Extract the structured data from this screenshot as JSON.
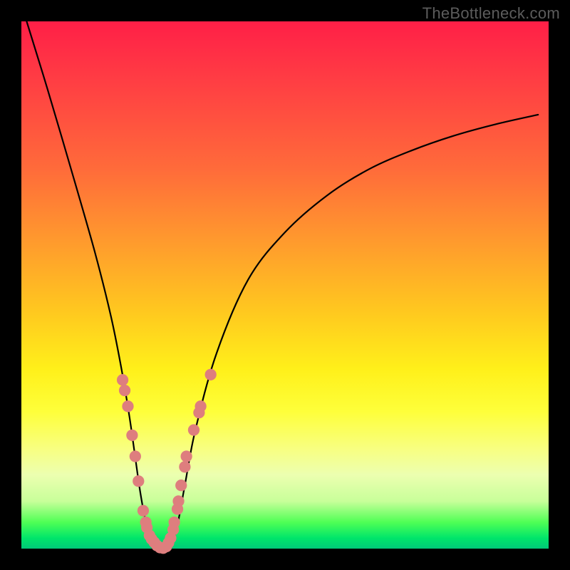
{
  "watermark": "TheBottleneck.com",
  "colors": {
    "frame_bg": "#000000",
    "curve": "#000000",
    "dot_fill": "#de7e7e",
    "dot_stroke": "#c46b6b",
    "gradient_stops": [
      "#ff1f47",
      "#ff6b3a",
      "#ffc81f",
      "#feff3a",
      "#4fff55",
      "#00c878"
    ]
  },
  "chart_data": {
    "type": "line",
    "title": "",
    "xlabel": "",
    "ylabel": "",
    "xlim": [
      0,
      1
    ],
    "ylim": [
      0,
      1
    ],
    "note": "Abstract V-shaped bottleneck curve on gradient background; no axis ticks or numeric labels are rendered in the image.",
    "series": [
      {
        "name": "bottleneck-curve",
        "x": [
          0.01,
          0.05,
          0.1,
          0.14,
          0.17,
          0.19,
          0.205,
          0.215,
          0.225,
          0.235,
          0.245,
          0.255,
          0.27,
          0.283,
          0.295,
          0.31,
          0.33,
          0.37,
          0.43,
          0.5,
          0.58,
          0.66,
          0.74,
          0.82,
          0.9,
          0.98
        ],
        "y": [
          1.0,
          0.87,
          0.7,
          0.56,
          0.44,
          0.34,
          0.25,
          0.18,
          0.11,
          0.055,
          0.018,
          0.005,
          0.0,
          0.005,
          0.04,
          0.12,
          0.225,
          0.37,
          0.51,
          0.6,
          0.67,
          0.72,
          0.755,
          0.783,
          0.805,
          0.823
        ]
      }
    ],
    "dots": [
      {
        "x": 0.192,
        "y": 0.32
      },
      {
        "x": 0.196,
        "y": 0.3
      },
      {
        "x": 0.202,
        "y": 0.27
      },
      {
        "x": 0.21,
        "y": 0.215
      },
      {
        "x": 0.216,
        "y": 0.175
      },
      {
        "x": 0.222,
        "y": 0.128
      },
      {
        "x": 0.231,
        "y": 0.072
      },
      {
        "x": 0.236,
        "y": 0.05
      },
      {
        "x": 0.238,
        "y": 0.04
      },
      {
        "x": 0.243,
        "y": 0.025
      },
      {
        "x": 0.247,
        "y": 0.018
      },
      {
        "x": 0.252,
        "y": 0.012
      },
      {
        "x": 0.257,
        "y": 0.006
      },
      {
        "x": 0.263,
        "y": 0.002
      },
      {
        "x": 0.269,
        "y": 0.001
      },
      {
        "x": 0.275,
        "y": 0.004
      },
      {
        "x": 0.279,
        "y": 0.011
      },
      {
        "x": 0.283,
        "y": 0.02
      },
      {
        "x": 0.288,
        "y": 0.036
      },
      {
        "x": 0.29,
        "y": 0.05
      },
      {
        "x": 0.296,
        "y": 0.075
      },
      {
        "x": 0.298,
        "y": 0.09
      },
      {
        "x": 0.303,
        "y": 0.12
      },
      {
        "x": 0.31,
        "y": 0.155
      },
      {
        "x": 0.313,
        "y": 0.175
      },
      {
        "x": 0.327,
        "y": 0.225
      },
      {
        "x": 0.337,
        "y": 0.258
      },
      {
        "x": 0.34,
        "y": 0.27
      },
      {
        "x": 0.359,
        "y": 0.33
      }
    ],
    "dot_radius_norm": 0.011
  }
}
